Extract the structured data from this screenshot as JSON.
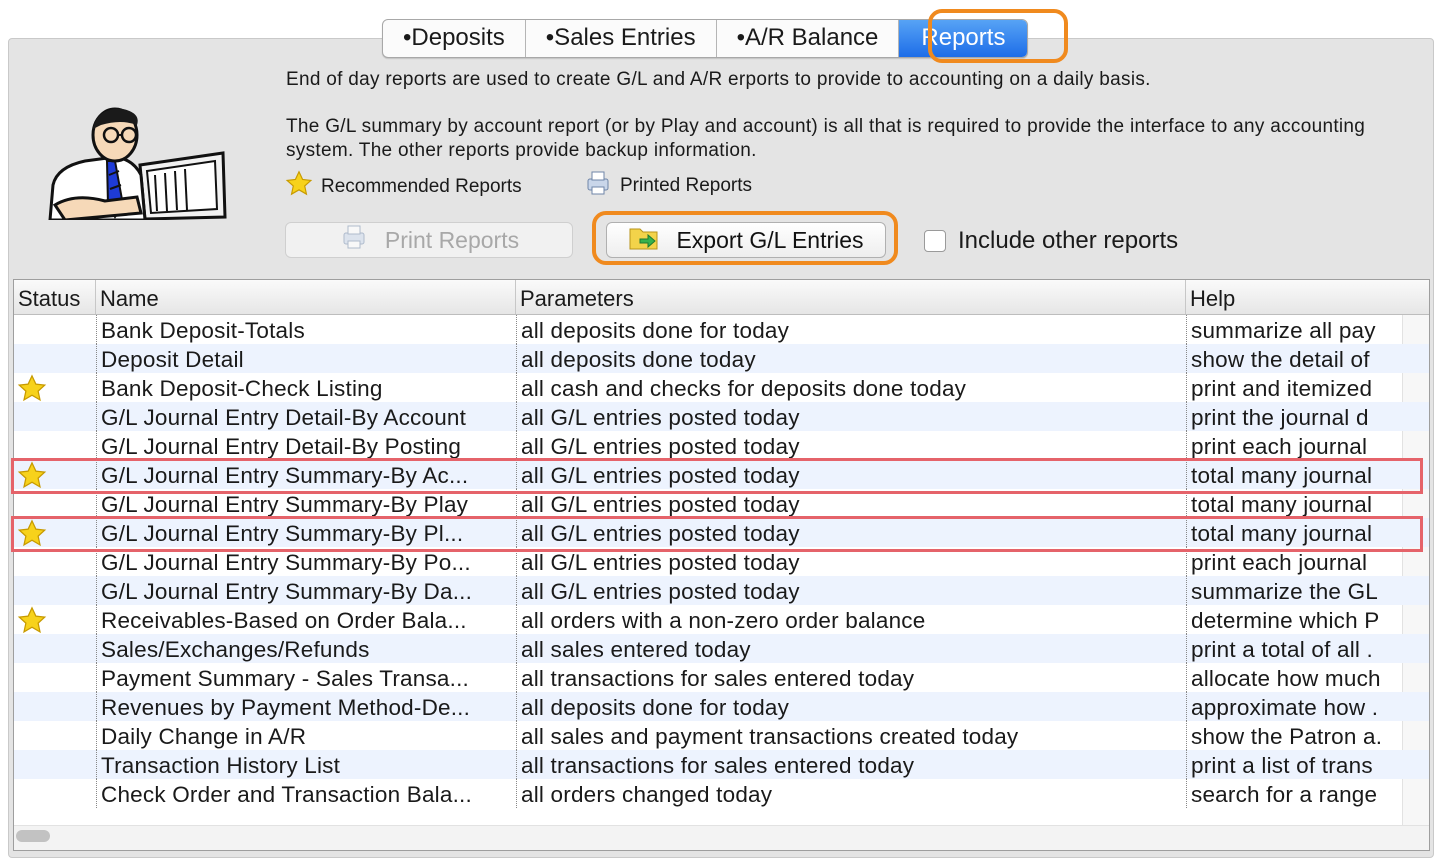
{
  "tabs": [
    {
      "label": "•Deposits",
      "active": false
    },
    {
      "label": "•Sales Entries",
      "active": false
    },
    {
      "label": "•A/R Balance",
      "active": false
    },
    {
      "label": "Reports",
      "active": true
    }
  ],
  "description": {
    "line1": "End of day reports are used to create G/L and A/R erports to provide to accounting on a daily basis.",
    "line2": "The G/L summary by account report (or by Play and account) is all that is required to provide the interface to any accounting system.  The other reports provide backup information."
  },
  "legend": {
    "recommended": "Recommended Reports",
    "printed": "Printed Reports"
  },
  "buttons": {
    "print": "Print Reports",
    "export": "Export G/L Entries",
    "include_other": "Include other reports"
  },
  "table": {
    "headers": {
      "status": "Status",
      "name": "Name",
      "params": "Parameters",
      "help": "Help"
    },
    "rows": [
      {
        "star": false,
        "name": "Bank Deposit-Totals",
        "params": "all deposits done for today",
        "help": "summarize all pay"
      },
      {
        "star": false,
        "name": "Deposit Detail",
        "params": "all deposits done today",
        "help": "show the detail of"
      },
      {
        "star": true,
        "name": "Bank Deposit-Check Listing",
        "params": "all cash and checks for deposits done today",
        "help": "print and itemized"
      },
      {
        "star": false,
        "name": "G/L Journal Entry Detail-By Account",
        "params": "all G/L entries posted today",
        "help": "print the journal d"
      },
      {
        "star": false,
        "name": "G/L Journal Entry Detail-By Posting",
        "params": "all G/L entries posted today",
        "help": "print each journal"
      },
      {
        "star": true,
        "name": "G/L Journal Entry Summary-By Ac...",
        "params": "all G/L entries posted today",
        "help": "total many journal"
      },
      {
        "star": false,
        "name": "G/L Journal Entry Summary-By Play",
        "params": "all G/L entries posted today",
        "help": "total many journal"
      },
      {
        "star": true,
        "name": "G/L Journal Entry Summary-By Pl...",
        "params": "all G/L entries posted today",
        "help": "total many journal"
      },
      {
        "star": false,
        "name": "G/L Journal Entry Summary-By Po...",
        "params": "all G/L entries posted today",
        "help": "print each journal"
      },
      {
        "star": false,
        "name": "G/L Journal Entry Summary-By Da...",
        "params": "all G/L entries posted today",
        "help": "summarize the GL"
      },
      {
        "star": true,
        "name": "Receivables-Based on Order Bala...",
        "params": "all orders with a non-zero order balance",
        "help": "determine which P"
      },
      {
        "star": false,
        "name": "Sales/Exchanges/Refunds",
        "params": "all sales entered today",
        "help": "print a total of all ."
      },
      {
        "star": false,
        "name": "Payment Summary - Sales Transa...",
        "params": "all transactions for sales entered today",
        "help": "allocate how much"
      },
      {
        "star": false,
        "name": "Revenues by Payment Method-De...",
        "params": "all deposits done for today",
        "help": "approximate how ."
      },
      {
        "star": false,
        "name": "Daily Change in A/R",
        "params": "all sales and payment transactions created today",
        "help": "show the Patron a."
      },
      {
        "star": false,
        "name": "Transaction History List",
        "params": "all transactions for sales entered today",
        "help": "print a list of trans"
      },
      {
        "star": false,
        "name": "Check Order and Transaction Bala...",
        "params": "all orders changed today",
        "help": "search for a range"
      }
    ]
  },
  "colors": {
    "highlight_orange": "#f08a1e",
    "highlight_red": "#e5636a",
    "active_tab": "#1d6de8",
    "star_yellow": "#f7d21b"
  }
}
